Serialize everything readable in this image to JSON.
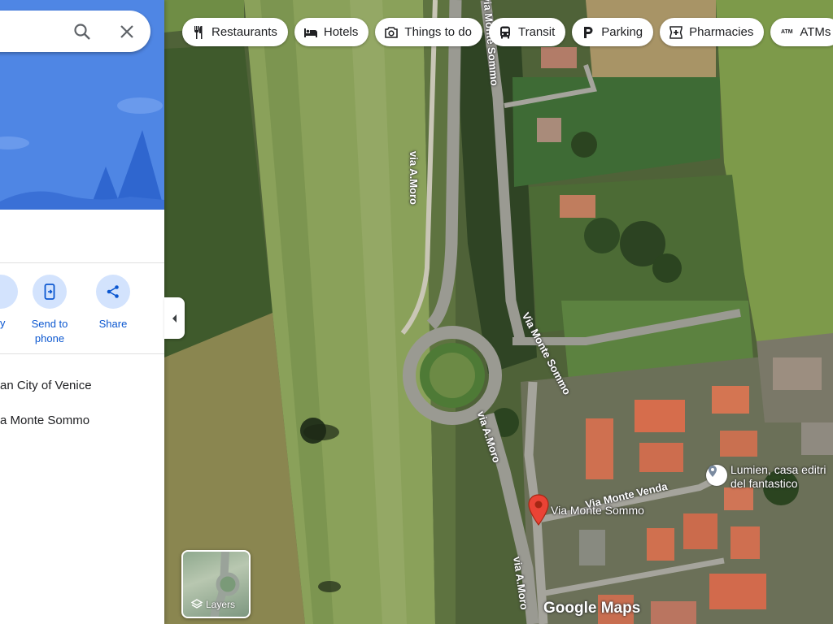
{
  "chips": [
    {
      "label": "Restaurants",
      "icon": "fork-knife-icon"
    },
    {
      "label": "Hotels",
      "icon": "bed-icon"
    },
    {
      "label": "Things to do",
      "icon": "camera-icon"
    },
    {
      "label": "Transit",
      "icon": "bus-icon"
    },
    {
      "label": "Parking",
      "icon": "parking-icon"
    },
    {
      "label": "Pharmacies",
      "icon": "pharmacy-icon"
    },
    {
      "label": "ATMs",
      "icon": "atm-icon"
    }
  ],
  "panel": {
    "actions": {
      "partial_label": "y",
      "send_to_phone": "Send to\nphone",
      "share": "Share"
    },
    "info": {
      "line1": "an City of Venice",
      "line2": "a Monte Sommo"
    }
  },
  "map": {
    "road_labels": {
      "via_moro_top": "via A.Moro",
      "via_monte_sommo_top": "via Monte Sommo",
      "via_monte_sommo_mid": "Via Monte Sommo",
      "via_moro_mid": "via A.Moro",
      "via_monte_venda": "Via Monte Venda",
      "via_moro_bottom": "via A.Moro"
    },
    "pin_label": "Via Monte Sommo",
    "poi_label_line1": "Lumien, casa editri",
    "poi_label_line2": "del fantastico",
    "logo": "Google Maps"
  },
  "layers_label": "Layers",
  "colors": {
    "pin": "#ea4335",
    "accent": "#0b57d0",
    "hero": "#4f86e4"
  }
}
